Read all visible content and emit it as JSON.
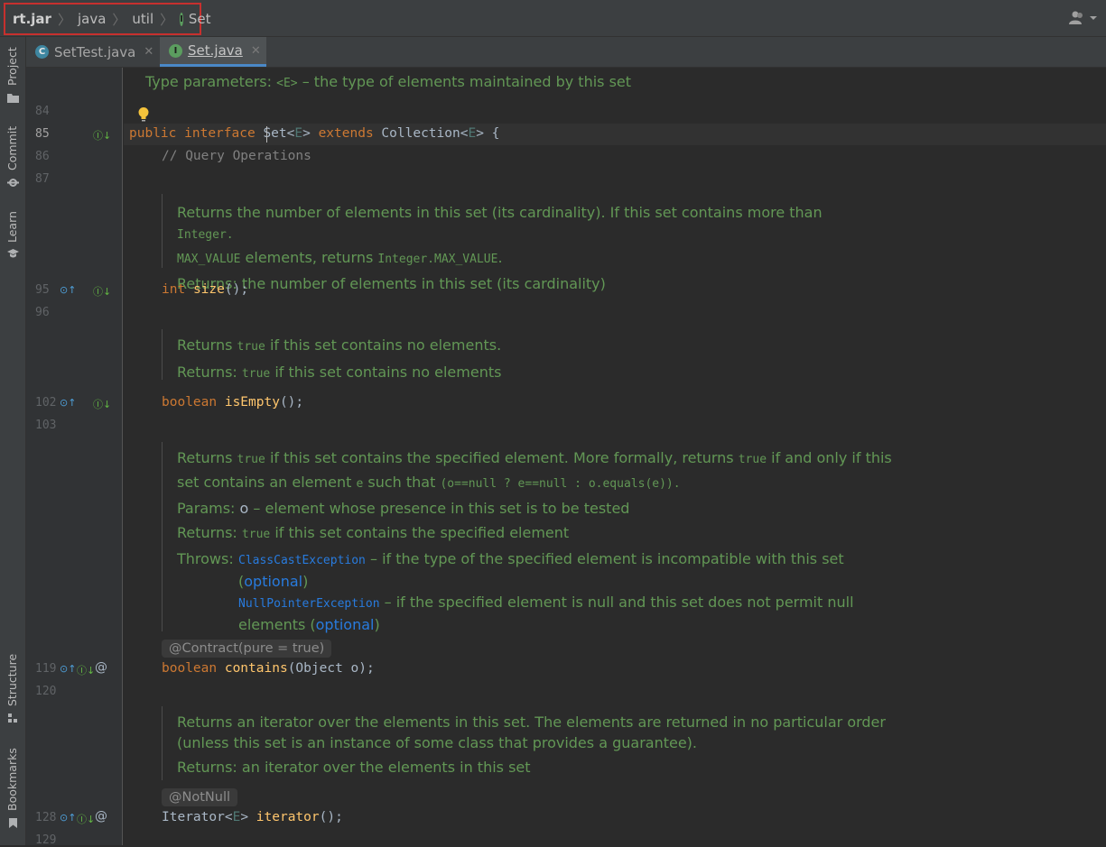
{
  "breadcrumb": {
    "items": [
      "rt.jar",
      "java",
      "util",
      "Set"
    ]
  },
  "toolstrip": {
    "project": "Project",
    "commit": "Commit",
    "learn": "Learn",
    "structure": "Structure",
    "bookmarks": "Bookmarks"
  },
  "tabs": [
    {
      "label": "SetTest.java",
      "icon": "C"
    },
    {
      "label": "Set.java",
      "icon": "I"
    }
  ],
  "gutter": {
    "lines": [
      "84",
      "85",
      "86",
      "87",
      "95",
      "96",
      "102",
      "103",
      "119",
      "120",
      "128",
      "129"
    ]
  },
  "code": {
    "type_params_label": "Type parameters:",
    "type_params_value": "<E>",
    "type_params_desc": "– the type of elements maintained by this set",
    "line85": {
      "public": "public",
      "interface": "interface",
      "name": "Set",
      "lt": "<",
      "E": "E",
      "gt": ">",
      "extends": "extends",
      "collection": "Collection",
      "E2": "E",
      "brace": "> {"
    },
    "line86": "// Query Operations",
    "size_doc": {
      "p1a": "Returns the number of elements in this set (its cardinality). If this set contains more than",
      "p1_mono1": "Integer.",
      "p1_mono2": "MAX_VALUE",
      "p1b": "elements, returns",
      "p1_mono3": "Integer.MAX_VALUE",
      "p1c": ".",
      "returns": "Returns: the number of elements in this set (its cardinality)"
    },
    "size_sig": {
      "type": "int",
      "name": "size",
      "rest": "();"
    },
    "empty_doc": {
      "p1a": "Returns",
      "p1_mono": "true",
      "p1b": "if this set contains no elements.",
      "ret_label": "Returns:",
      "ret_mono": "true",
      "ret_text": "if this set contains no elements"
    },
    "empty_sig": {
      "type": "boolean",
      "name": "isEmpty",
      "rest": "();"
    },
    "contains_doc": {
      "p1a": "Returns",
      "p1_mono1": "true",
      "p1b": "if this set contains the specified element. More formally, returns",
      "p1_mono2": "true",
      "p1c": "if and only if this",
      "p2a": "set contains an element",
      "p2_mono1": "e",
      "p2b": "such that",
      "p2_mono2": "(o==null  ?  e==null  :  o.equals(e)).",
      "params_label": "Params:",
      "params_o": "o",
      "params_text": "– element whose presence in this set is to be tested",
      "ret_label": "Returns:",
      "ret_mono": "true",
      "ret_text": "if this set contains the specified element",
      "throws_label": "Throws:",
      "ex1": "ClassCastException",
      "ex1_text": "– if the type of the specified element is incompatible with this set",
      "ex1_open": "(",
      "ex1_opt": "optional",
      "ex1_close": ")",
      "ex2": "NullPointerException",
      "ex2_text": "– if the specified element is null and this set does not permit null",
      "ex2_text2": "elements (",
      "ex2_opt": "optional",
      "ex2_close": ")"
    },
    "contains_anno": "@Contract(pure = true)",
    "contains_sig": {
      "type": "boolean",
      "name": "contains",
      "rest": "(Object o);"
    },
    "iter_doc": {
      "p1": "Returns an iterator over the elements in this set. The elements are returned in no particular order",
      "p2": "(unless this set is an instance of some class that provides a guarantee).",
      "returns": "Returns: an iterator over the elements in this set"
    },
    "iter_anno": "@NotNull",
    "iter_sig": {
      "type": "Iterator",
      "lt": "<",
      "E": "E",
      "gt": ">",
      "name": "iterator",
      "rest": "();"
    }
  }
}
